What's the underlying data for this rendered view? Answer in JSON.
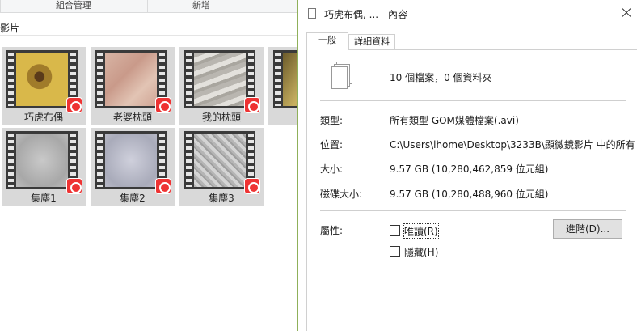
{
  "explorer": {
    "ribbon": {
      "groups": [
        "組合管理",
        "新增"
      ]
    },
    "address_text": "影片",
    "files": [
      {
        "name": "巧虎布偶"
      },
      {
        "name": "老婆枕頭"
      },
      {
        "name": "我的枕頭"
      },
      {
        "name": "集塵1"
      },
      {
        "name": "集塵2"
      },
      {
        "name": "集塵3"
      }
    ]
  },
  "dialog": {
    "title": "巧虎布偶, ... - 內容",
    "tabs": [
      {
        "label": "一般"
      },
      {
        "label": "詳細資料"
      }
    ],
    "summary": "10 個檔案，0 個資料夾",
    "type": {
      "label": "類型:",
      "value": "所有類型 GOM媒體檔案(.avi)"
    },
    "location": {
      "label": "位置:",
      "value": "C:\\Users\\lhome\\Desktop\\3233B\\顯微鏡影片 中的所有"
    },
    "size": {
      "label": "大小:",
      "value": "9.57 GB (10,280,462,859 位元組)"
    },
    "disk_size": {
      "label": "磁碟大小:",
      "value": "9.57 GB (10,280,488,960 位元組)"
    },
    "attributes": {
      "label": "屬性:",
      "readonly_label": "唯讀(R)",
      "hidden_label": "隱藏(H)",
      "advanced_button": "進階(D)..."
    }
  }
}
